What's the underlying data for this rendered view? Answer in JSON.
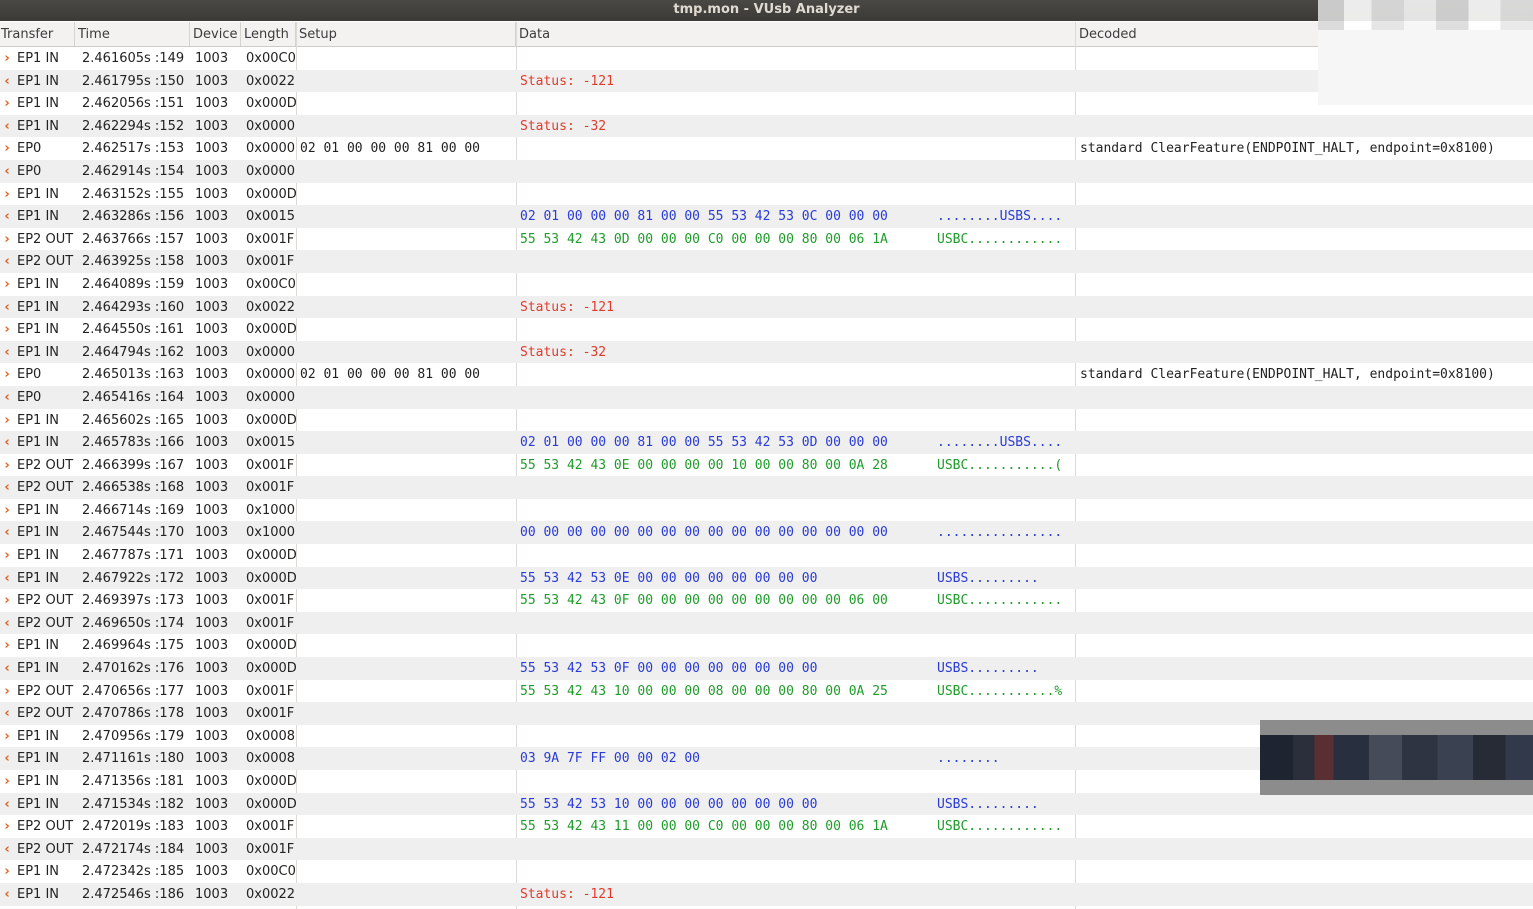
{
  "window": {
    "title": "tmp.mon - VUsb Analyzer"
  },
  "columns": {
    "transfer": "Transfer",
    "time": "Time",
    "device": "Device",
    "length": "Length",
    "setup": "Setup",
    "data": "Data",
    "decoded": "Decoded"
  },
  "colors": {
    "arrow": "#e2601c",
    "status": "#e23a2a",
    "in_data": "#2a3bd6",
    "out_data": "#1f9c2a"
  },
  "rows": [
    {
      "dir": ">",
      "transfer": "EP1 IN",
      "time": "2.461605s :149",
      "device": "1003",
      "length": "0x00C0",
      "setup": "",
      "data": "",
      "ascii": "",
      "decoded": "",
      "kind": ""
    },
    {
      "dir": "<",
      "transfer": "EP1 IN",
      "time": "2.461795s :150",
      "device": "1003",
      "length": "0x0022",
      "setup": "",
      "data": "Status: -121",
      "ascii": "",
      "decoded": "",
      "kind": "status"
    },
    {
      "dir": ">",
      "transfer": "EP1 IN",
      "time": "2.462056s :151",
      "device": "1003",
      "length": "0x000D",
      "setup": "",
      "data": "",
      "ascii": "",
      "decoded": "",
      "kind": ""
    },
    {
      "dir": "<",
      "transfer": "EP1 IN",
      "time": "2.462294s :152",
      "device": "1003",
      "length": "0x0000",
      "setup": "",
      "data": "Status: -32",
      "ascii": "",
      "decoded": "",
      "kind": "status"
    },
    {
      "dir": ">",
      "transfer": "EP0",
      "time": "2.462517s :153",
      "device": "1003",
      "length": "0x0000",
      "setup": "02 01 00 00 00 81 00 00",
      "data": "",
      "ascii": "",
      "decoded": "standard ClearFeature(ENDPOINT_HALT, endpoint=0x8100)",
      "kind": ""
    },
    {
      "dir": "<",
      "transfer": "EP0",
      "time": "2.462914s :154",
      "device": "1003",
      "length": "0x0000",
      "setup": "",
      "data": "",
      "ascii": "",
      "decoded": "",
      "kind": ""
    },
    {
      "dir": ">",
      "transfer": "EP1 IN",
      "time": "2.463152s :155",
      "device": "1003",
      "length": "0x000D",
      "setup": "",
      "data": "",
      "ascii": "",
      "decoded": "",
      "kind": ""
    },
    {
      "dir": "<",
      "transfer": "EP1 IN",
      "time": "2.463286s :156",
      "device": "1003",
      "length": "0x0015",
      "setup": "",
      "data": "02 01 00 00 00 81 00 00 55 53 42 53 0C 00 00 00",
      "ascii": "........USBS....",
      "decoded": "",
      "kind": "in"
    },
    {
      "dir": ">",
      "transfer": "EP2 OUT",
      "time": "2.463766s :157",
      "device": "1003",
      "length": "0x001F",
      "setup": "",
      "data": "55 53 42 43 0D 00 00 00 C0 00 00 00 80 00 06 1A",
      "ascii": "USBC............",
      "decoded": "",
      "kind": "out"
    },
    {
      "dir": "<",
      "transfer": "EP2 OUT",
      "time": "2.463925s :158",
      "device": "1003",
      "length": "0x001F",
      "setup": "",
      "data": "",
      "ascii": "",
      "decoded": "",
      "kind": ""
    },
    {
      "dir": ">",
      "transfer": "EP1 IN",
      "time": "2.464089s :159",
      "device": "1003",
      "length": "0x00C0",
      "setup": "",
      "data": "",
      "ascii": "",
      "decoded": "",
      "kind": ""
    },
    {
      "dir": "<",
      "transfer": "EP1 IN",
      "time": "2.464293s :160",
      "device": "1003",
      "length": "0x0022",
      "setup": "",
      "data": "Status: -121",
      "ascii": "",
      "decoded": "",
      "kind": "status"
    },
    {
      "dir": ">",
      "transfer": "EP1 IN",
      "time": "2.464550s :161",
      "device": "1003",
      "length": "0x000D",
      "setup": "",
      "data": "",
      "ascii": "",
      "decoded": "",
      "kind": ""
    },
    {
      "dir": "<",
      "transfer": "EP1 IN",
      "time": "2.464794s :162",
      "device": "1003",
      "length": "0x0000",
      "setup": "",
      "data": "Status: -32",
      "ascii": "",
      "decoded": "",
      "kind": "status"
    },
    {
      "dir": ">",
      "transfer": "EP0",
      "time": "2.465013s :163",
      "device": "1003",
      "length": "0x0000",
      "setup": "02 01 00 00 00 81 00 00",
      "data": "",
      "ascii": "",
      "decoded": "standard ClearFeature(ENDPOINT_HALT, endpoint=0x8100)",
      "kind": ""
    },
    {
      "dir": "<",
      "transfer": "EP0",
      "time": "2.465416s :164",
      "device": "1003",
      "length": "0x0000",
      "setup": "",
      "data": "",
      "ascii": "",
      "decoded": "",
      "kind": ""
    },
    {
      "dir": ">",
      "transfer": "EP1 IN",
      "time": "2.465602s :165",
      "device": "1003",
      "length": "0x000D",
      "setup": "",
      "data": "",
      "ascii": "",
      "decoded": "",
      "kind": ""
    },
    {
      "dir": "<",
      "transfer": "EP1 IN",
      "time": "2.465783s :166",
      "device": "1003",
      "length": "0x0015",
      "setup": "",
      "data": "02 01 00 00 00 81 00 00 55 53 42 53 0D 00 00 00",
      "ascii": "........USBS....",
      "decoded": "",
      "kind": "in"
    },
    {
      "dir": ">",
      "transfer": "EP2 OUT",
      "time": "2.466399s :167",
      "device": "1003",
      "length": "0x001F",
      "setup": "",
      "data": "55 53 42 43 0E 00 00 00 00 10 00 00 80 00 0A 28",
      "ascii": "USBC...........(",
      "decoded": "",
      "kind": "out"
    },
    {
      "dir": "<",
      "transfer": "EP2 OUT",
      "time": "2.466538s :168",
      "device": "1003",
      "length": "0x001F",
      "setup": "",
      "data": "",
      "ascii": "",
      "decoded": "",
      "kind": ""
    },
    {
      "dir": ">",
      "transfer": "EP1 IN",
      "time": "2.466714s :169",
      "device": "1003",
      "length": "0x1000",
      "setup": "",
      "data": "",
      "ascii": "",
      "decoded": "",
      "kind": ""
    },
    {
      "dir": "<",
      "transfer": "EP1 IN",
      "time": "2.467544s :170",
      "device": "1003",
      "length": "0x1000",
      "setup": "",
      "data": "00 00 00 00 00 00 00 00 00 00 00 00 00 00 00 00",
      "ascii": "................",
      "decoded": "",
      "kind": "in"
    },
    {
      "dir": ">",
      "transfer": "EP1 IN",
      "time": "2.467787s :171",
      "device": "1003",
      "length": "0x000D",
      "setup": "",
      "data": "",
      "ascii": "",
      "decoded": "",
      "kind": ""
    },
    {
      "dir": "<",
      "transfer": "EP1 IN",
      "time": "2.467922s :172",
      "device": "1003",
      "length": "0x000D",
      "setup": "",
      "data": "55 53 42 53 0E 00 00 00 00 00 00 00 00",
      "ascii": "USBS.........",
      "decoded": "",
      "kind": "in"
    },
    {
      "dir": ">",
      "transfer": "EP2 OUT",
      "time": "2.469397s :173",
      "device": "1003",
      "length": "0x001F",
      "setup": "",
      "data": "55 53 42 43 0F 00 00 00 00 00 00 00 00 00 06 00",
      "ascii": "USBC............",
      "decoded": "",
      "kind": "out"
    },
    {
      "dir": "<",
      "transfer": "EP2 OUT",
      "time": "2.469650s :174",
      "device": "1003",
      "length": "0x001F",
      "setup": "",
      "data": "",
      "ascii": "",
      "decoded": "",
      "kind": ""
    },
    {
      "dir": ">",
      "transfer": "EP1 IN",
      "time": "2.469964s :175",
      "device": "1003",
      "length": "0x000D",
      "setup": "",
      "data": "",
      "ascii": "",
      "decoded": "",
      "kind": ""
    },
    {
      "dir": "<",
      "transfer": "EP1 IN",
      "time": "2.470162s :176",
      "device": "1003",
      "length": "0x000D",
      "setup": "",
      "data": "55 53 42 53 0F 00 00 00 00 00 00 00 00",
      "ascii": "USBS.........",
      "decoded": "",
      "kind": "in"
    },
    {
      "dir": ">",
      "transfer": "EP2 OUT",
      "time": "2.470656s :177",
      "device": "1003",
      "length": "0x001F",
      "setup": "",
      "data": "55 53 42 43 10 00 00 00 08 00 00 00 80 00 0A 25",
      "ascii": "USBC...........%",
      "decoded": "",
      "kind": "out"
    },
    {
      "dir": "<",
      "transfer": "EP2 OUT",
      "time": "2.470786s :178",
      "device": "1003",
      "length": "0x001F",
      "setup": "",
      "data": "",
      "ascii": "",
      "decoded": "",
      "kind": ""
    },
    {
      "dir": ">",
      "transfer": "EP1 IN",
      "time": "2.470956s :179",
      "device": "1003",
      "length": "0x0008",
      "setup": "",
      "data": "",
      "ascii": "",
      "decoded": "",
      "kind": ""
    },
    {
      "dir": "<",
      "transfer": "EP1 IN",
      "time": "2.471161s :180",
      "device": "1003",
      "length": "0x0008",
      "setup": "",
      "data": "03 9A 7F FF 00 00 02 00",
      "ascii": "........",
      "decoded": "",
      "kind": "in"
    },
    {
      "dir": ">",
      "transfer": "EP1 IN",
      "time": "2.471356s :181",
      "device": "1003",
      "length": "0x000D",
      "setup": "",
      "data": "",
      "ascii": "",
      "decoded": "",
      "kind": ""
    },
    {
      "dir": "<",
      "transfer": "EP1 IN",
      "time": "2.471534s :182",
      "device": "1003",
      "length": "0x000D",
      "setup": "",
      "data": "55 53 42 53 10 00 00 00 00 00 00 00 00",
      "ascii": "USBS.........",
      "decoded": "",
      "kind": "in"
    },
    {
      "dir": ">",
      "transfer": "EP2 OUT",
      "time": "2.472019s :183",
      "device": "1003",
      "length": "0x001F",
      "setup": "",
      "data": "55 53 42 43 11 00 00 00 C0 00 00 00 80 00 06 1A",
      "ascii": "USBC............",
      "decoded": "",
      "kind": "out"
    },
    {
      "dir": "<",
      "transfer": "EP2 OUT",
      "time": "2.472174s :184",
      "device": "1003",
      "length": "0x001F",
      "setup": "",
      "data": "",
      "ascii": "",
      "decoded": "",
      "kind": ""
    },
    {
      "dir": ">",
      "transfer": "EP1 IN",
      "time": "2.472342s :185",
      "device": "1003",
      "length": "0x00C0",
      "setup": "",
      "data": "",
      "ascii": "",
      "decoded": "",
      "kind": ""
    },
    {
      "dir": "<",
      "transfer": "EP1 IN",
      "time": "2.472546s :186",
      "device": "1003",
      "length": "0x0022",
      "setup": "",
      "data": "Status: -121",
      "ascii": "",
      "decoded": "",
      "kind": "status"
    }
  ]
}
